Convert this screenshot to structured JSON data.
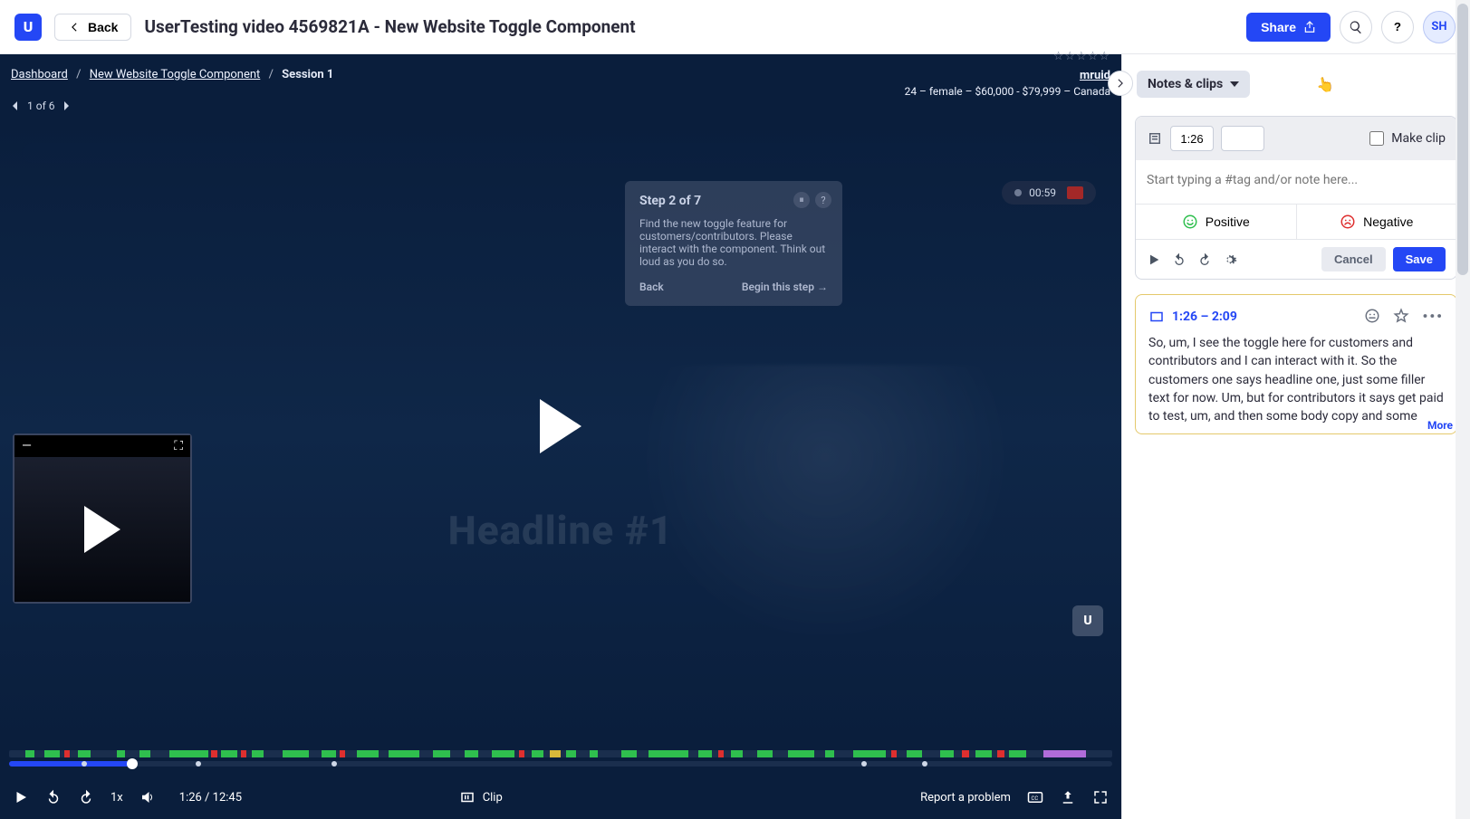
{
  "header": {
    "back_label": "Back",
    "title": "UserTesting video 4569821A - New Website Toggle Component",
    "share_label": "Share",
    "avatar_initials": "SH"
  },
  "breadcrumb": {
    "dashboard": "Dashboard",
    "project": "New Website Toggle Component",
    "session": "Session 1"
  },
  "participant": {
    "username": "mruid",
    "meta": "24 – female – $60,000 - $79,999 – Canada"
  },
  "pager": {
    "label": "1 of 6"
  },
  "task_card": {
    "step_title": "Step 2 of 7",
    "body": "Find the new toggle feature for customers/contributors. Please interact with the component. Think out loud as you do so.",
    "back": "Back",
    "begin": "Begin this step →"
  },
  "recorder": {
    "time": "00:59"
  },
  "ghost_headline": "Headline #1",
  "controls": {
    "speed": "1x",
    "time": "1:26 / 12:45",
    "clip_label": "Clip",
    "report": "Report a problem"
  },
  "side": {
    "tab_label": "Notes & clips",
    "editor": {
      "time_in": "1:26",
      "make_clip_label": "Make clip",
      "placeholder": "Start typing a #tag and/or note here...",
      "positive": "Positive",
      "negative": "Negative",
      "cancel": "Cancel",
      "save": "Save"
    },
    "clip": {
      "range": "1:26 – 2:09",
      "text": "So, um, I see the toggle here for customers and contributors and I can interact with it. So the customers one says headline one, just some filler text for now. Um, but for contributors it says get paid to test, um, and then some body copy and some CTAs here. Okay. Okay. Um, think out loud. I, I think that's pretty intuitive, like when I first",
      "more": "More"
    }
  },
  "progress": {
    "percent": 11.2
  },
  "timeline_segments": [
    {
      "c": "g",
      "l": 1.5,
      "w": 0.8
    },
    {
      "c": "g",
      "l": 3.2,
      "w": 1.4
    },
    {
      "c": "r",
      "l": 5.0,
      "w": 0.5
    },
    {
      "c": "g",
      "l": 6.2,
      "w": 1.2
    },
    {
      "c": "g",
      "l": 9.8,
      "w": 0.7
    },
    {
      "c": "g",
      "l": 11.8,
      "w": 1.0
    },
    {
      "c": "g",
      "l": 14.5,
      "w": 3.6
    },
    {
      "c": "r",
      "l": 18.3,
      "w": 0.6
    },
    {
      "c": "g",
      "l": 19.2,
      "w": 1.5
    },
    {
      "c": "r",
      "l": 21.0,
      "w": 0.5
    },
    {
      "c": "g",
      "l": 22.0,
      "w": 1.1
    },
    {
      "c": "g",
      "l": 24.8,
      "w": 2.4
    },
    {
      "c": "g",
      "l": 28.3,
      "w": 1.3
    },
    {
      "c": "r",
      "l": 30.0,
      "w": 0.5
    },
    {
      "c": "g",
      "l": 31.5,
      "w": 2.0
    },
    {
      "c": "g",
      "l": 34.4,
      "w": 2.8
    },
    {
      "c": "g",
      "l": 38.4,
      "w": 1.6
    },
    {
      "c": "g",
      "l": 41.3,
      "w": 1.2
    },
    {
      "c": "g",
      "l": 43.8,
      "w": 2.0
    },
    {
      "c": "r",
      "l": 46.2,
      "w": 0.5
    },
    {
      "c": "g",
      "l": 47.4,
      "w": 1.0
    },
    {
      "c": "y",
      "l": 49.0,
      "w": 1.0
    },
    {
      "c": "g",
      "l": 50.5,
      "w": 0.9
    },
    {
      "c": "g",
      "l": 52.6,
      "w": 0.8
    },
    {
      "c": "g",
      "l": 55.5,
      "w": 1.4
    },
    {
      "c": "g",
      "l": 58.0,
      "w": 3.6
    },
    {
      "c": "g",
      "l": 62.5,
      "w": 1.2
    },
    {
      "c": "r",
      "l": 64.3,
      "w": 0.5
    },
    {
      "c": "g",
      "l": 65.4,
      "w": 1.1
    },
    {
      "c": "g",
      "l": 67.8,
      "w": 1.4
    },
    {
      "c": "g",
      "l": 70.6,
      "w": 2.4
    },
    {
      "c": "g",
      "l": 74.0,
      "w": 0.8
    },
    {
      "c": "g",
      "l": 76.5,
      "w": 3.0
    },
    {
      "c": "r",
      "l": 80.0,
      "w": 0.5
    },
    {
      "c": "g",
      "l": 81.4,
      "w": 1.4
    },
    {
      "c": "g",
      "l": 84.4,
      "w": 1.2
    },
    {
      "c": "r",
      "l": 86.4,
      "w": 0.6
    },
    {
      "c": "g",
      "l": 87.6,
      "w": 1.5
    },
    {
      "c": "r",
      "l": 89.6,
      "w": 0.6
    },
    {
      "c": "g",
      "l": 90.6,
      "w": 1.6
    },
    {
      "c": "p",
      "l": 93.8,
      "w": 3.8
    }
  ],
  "progress_dots": [
    6.8,
    17.2,
    29.5,
    77.5,
    83.0
  ]
}
